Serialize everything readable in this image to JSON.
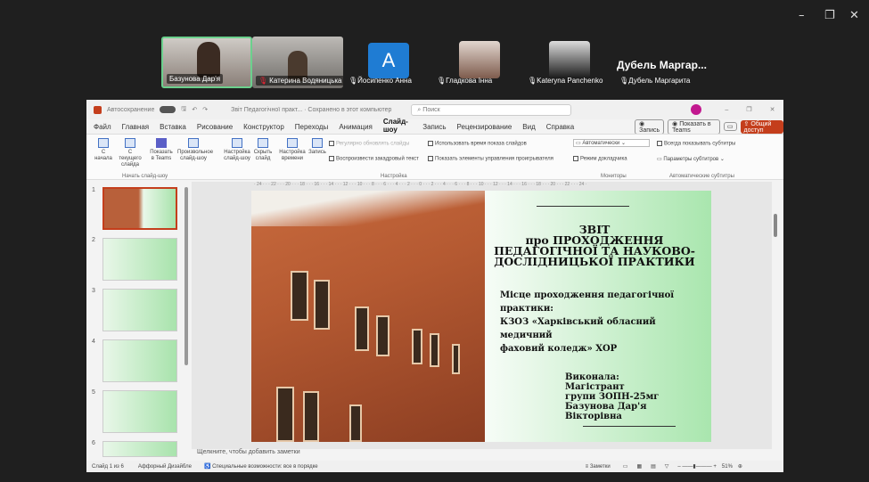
{
  "participants": [
    {
      "name": "Базунова Дар'я"
    },
    {
      "name": "Катерина Водяницька"
    },
    {
      "name": "Йосипенко Анна",
      "initial": "A"
    },
    {
      "name": "Гладкова Інна"
    },
    {
      "name": "Kateryna Panchenko"
    },
    {
      "name": "Дубель Маргарита"
    }
  ],
  "featured_name": "Дубель Маргар...",
  "ppt": {
    "title_hint": "Звіт Педагогічної практ... · Сохранено в этот компьютер",
    "search": "Поиск",
    "autosave": "Автосохранение",
    "record_btn": "Запись",
    "teams_btn": "Показать в Teams",
    "share_btn": "Общий доступ",
    "menu": [
      "Файл",
      "Главная",
      "Вставка",
      "Рисование",
      "Конструктор",
      "Переходы",
      "Анимация",
      "Слайд-шоу",
      "Запись",
      "Рецензирование",
      "Вид",
      "Справка"
    ],
    "ribbon": {
      "from_start": "С начала",
      "from_current": "С текущего слайда",
      "show_teams": "Показать в Teams",
      "custom": "Произвольное слайд-шоу",
      "setup": "Настройка слайд-шоу",
      "hide": "Скрыть слайд",
      "rehearse": "Настройка времени",
      "record": "Запись",
      "group_start": "Начать слайд-шоу",
      "update_slides": "Регулярно обновлять слайды",
      "play_narr": "Воспроизвести закадровый текст",
      "use_timings": "Использовать время показа слайдов",
      "show_media": "Показать элементы управления проигрывателя",
      "group_setup": "Настройка",
      "monitor": "Автоматически",
      "presenter": "Режим докладчика",
      "group_monitors": "Мониторы",
      "always_sub": "Всегда показывать субтитры",
      "sub_params": "Параметры субтитров",
      "group_sub": "Автоматические субтитры"
    },
    "ruler": "· 24 · · · 22 · · · 20 · · · 18 · · · 16 · · · 14 · · · 12 · · · 10 · · · 8 · · · 6 · · · 4 · · · 2 · · · 0 · · · 2 · · · 4 · · · 6 · · · 8 · · · 10 · · · 12 · · · 14 · · · 16 · · · 18 · · · 20 · · · 22 · · · 24 ·",
    "slide": {
      "title": "ЗВІТ\nпро ПРОХОДЖЕННЯ\nПЕДАГОГІЧНОЇ ТА НАУКОВО-\nДОСЛІДНИЦЬКОЇ ПРАКТИКИ",
      "place": "Місце проходження педагогічної практики:\nКЗОЗ «Харківський обласний медичний\nфаховий коледж» ХОР",
      "author": "Виконала:\nМагістрант\nгрупи ЗОПН-25мг\nБазунова Дар'я\nВікторівна"
    },
    "slide_numbers": [
      "1",
      "2",
      "3",
      "4",
      "5",
      "6"
    ],
    "notes": "Щелкните, чтобы добавить заметки",
    "status": {
      "slide": "Слайд 1 из 6",
      "theme": "Аффорный Дизайбле",
      "accessibility": "Специальные возможности: все в порядке",
      "notes_btn": "Заметки",
      "zoom": "51%"
    }
  },
  "colors": {
    "accent": "#c43e1c",
    "teams_bg": "#1f1f1f",
    "avatar": "#1f7cd3"
  }
}
